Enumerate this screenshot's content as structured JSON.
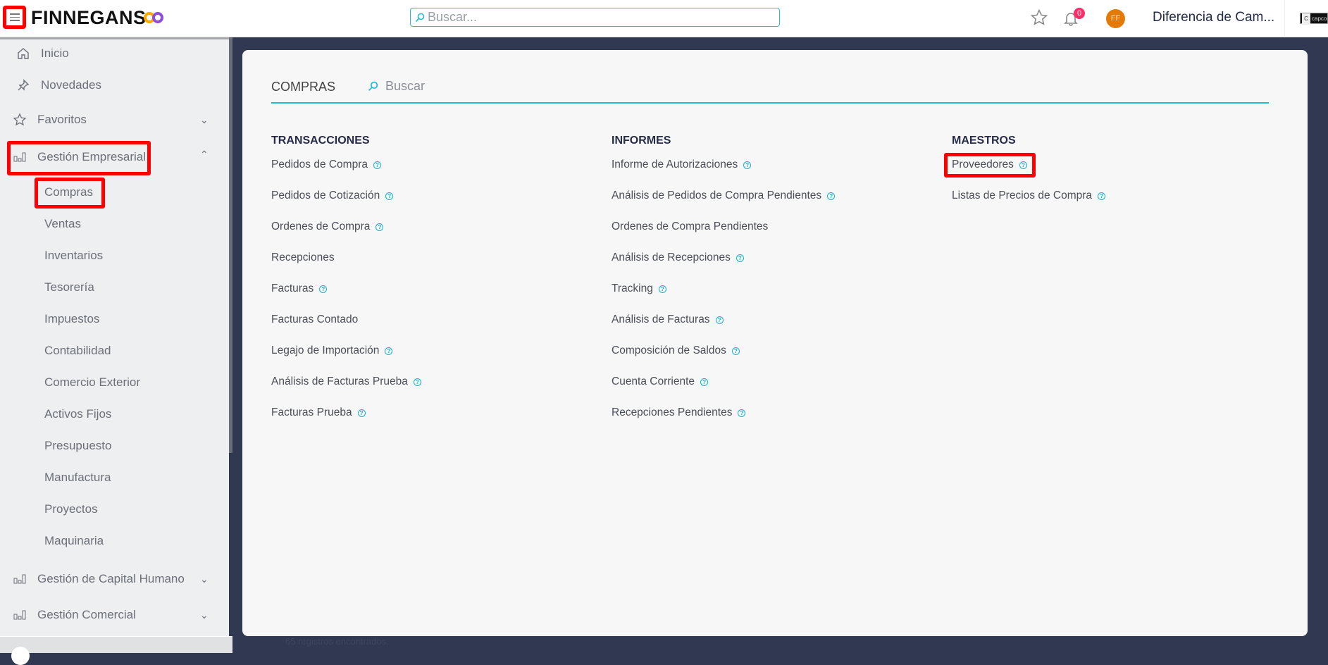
{
  "header": {
    "logo": "FINNEGANS",
    "search_placeholder": "Buscar...",
    "notifications_count": "0",
    "avatar_initials": "FF",
    "title": "Diferencia de Cam...",
    "brand_badge": "capco"
  },
  "sidebar": {
    "top": [
      {
        "label": "Inicio",
        "icon": "home-icon"
      },
      {
        "label": "Novedades",
        "icon": "pin-icon"
      }
    ],
    "favoritos": "Favoritos",
    "gestion_empresarial": "Gestión Empresarial",
    "subitems": [
      "Compras",
      "Ventas",
      "Inventarios",
      "Tesorería",
      "Impuestos",
      "Contabilidad",
      "Comercio Exterior",
      "Activos Fijos",
      "Presupuesto",
      "Manufactura",
      "Proyectos",
      "Maquinaria"
    ],
    "gestion_capital": "Gestión de Capital Humano",
    "gestion_comercial": "Gestión Comercial"
  },
  "content": {
    "title": "COMPRAS",
    "search_placeholder": "Buscar",
    "background_text": "65 registros encontrados.",
    "columns": [
      {
        "header": "TRANSACCIONES",
        "items": [
          {
            "label": "Pedidos de Compra",
            "help": true
          },
          {
            "label": "Pedidos de Cotización",
            "help": true
          },
          {
            "label": "Ordenes de Compra",
            "help": true
          },
          {
            "label": "Recepciones",
            "help": false
          },
          {
            "label": "Facturas",
            "help": true
          },
          {
            "label": "Facturas Contado",
            "help": false
          },
          {
            "label": "Legajo de Importación",
            "help": true
          },
          {
            "label": "Análisis de Facturas Prueba",
            "help": true
          },
          {
            "label": "Facturas Prueba",
            "help": true
          }
        ]
      },
      {
        "header": "INFORMES",
        "items": [
          {
            "label": "Informe de Autorizaciones",
            "help": true
          },
          {
            "label": "Análisis de Pedidos de Compra Pendientes",
            "help": true
          },
          {
            "label": "Ordenes de Compra Pendientes",
            "help": false
          },
          {
            "label": "Análisis de Recepciones",
            "help": true
          },
          {
            "label": "Tracking",
            "help": true
          },
          {
            "label": "Análisis de Facturas",
            "help": true
          },
          {
            "label": "Composición de Saldos",
            "help": true
          },
          {
            "label": "Cuenta Corriente",
            "help": true
          },
          {
            "label": "Recepciones Pendientes",
            "help": true
          }
        ]
      },
      {
        "header": "MAESTROS",
        "items": [
          {
            "label": "Proveedores",
            "help": true
          },
          {
            "label": "Listas de Precios de Compra",
            "help": true
          }
        ]
      }
    ]
  },
  "colors": {
    "accent": "#22bcd4",
    "highlight": "#ff0000",
    "avatar": "#e47a06",
    "badge": "#ff2c6a"
  }
}
